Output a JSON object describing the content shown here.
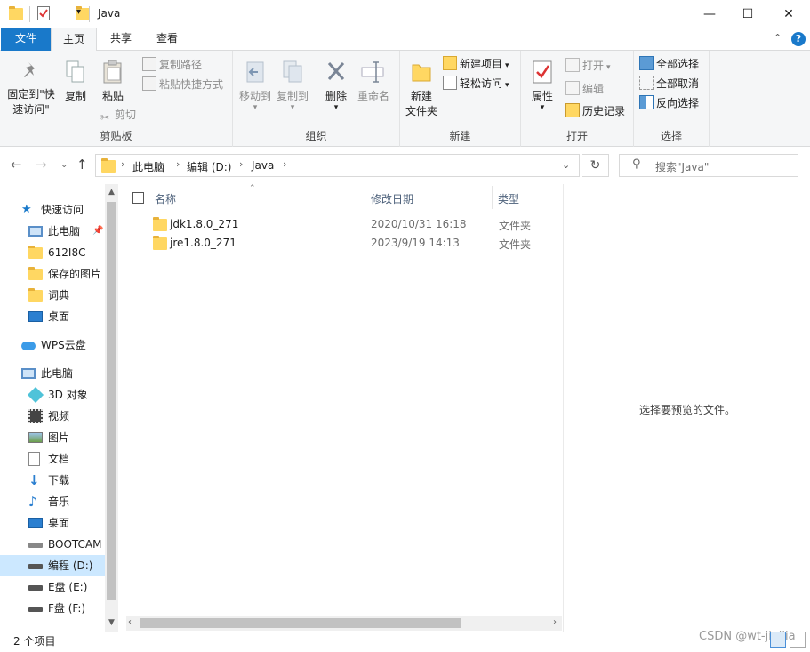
{
  "titlebar": {
    "title": "Java",
    "minimize": "—",
    "maximize": "☐",
    "close": "✕"
  },
  "tabs": {
    "file": "文件",
    "home": "主页",
    "share": "共享",
    "view": "查看"
  },
  "ribbon": {
    "clipboard": {
      "label": "剪贴板",
      "pin_line1": "固定到\"快",
      "pin_line2": "速访问\"",
      "copy": "复制",
      "paste": "粘贴",
      "copy_path": "复制路径",
      "paste_shortcut": "粘贴快捷方式",
      "cut": "剪切"
    },
    "organize": {
      "label": "组织",
      "move_to": "移动到",
      "copy_to": "复制到",
      "delete": "删除",
      "rename": "重命名"
    },
    "new": {
      "label": "新建",
      "new_folder_line1": "新建",
      "new_folder_line2": "文件夹",
      "new_item": "新建项目",
      "easy_access": "轻松访问"
    },
    "open": {
      "label": "打开",
      "properties": "属性",
      "open": "打开",
      "edit": "编辑",
      "history": "历史记录"
    },
    "select": {
      "label": "选择",
      "select_all": "全部选择",
      "select_none": "全部取消",
      "invert": "反向选择"
    }
  },
  "address": {
    "crumbs": [
      "此电脑",
      "编辑 (D:)",
      "Java"
    ],
    "search_placeholder": "搜索\"Java\""
  },
  "nav": {
    "items": [
      {
        "label": "快速访问",
        "icon": "star-icon"
      },
      {
        "label": "此电脑",
        "icon": "computer-icon"
      },
      {
        "label": "612I8C",
        "icon": "folder-icon"
      },
      {
        "label": "保存的图片",
        "icon": "folder-icon"
      },
      {
        "label": "词典",
        "icon": "folder-icon"
      },
      {
        "label": "桌面",
        "icon": "desktop-icon"
      },
      {
        "label": "WPS云盘",
        "icon": "cloud-icon"
      },
      {
        "label": "此电脑",
        "icon": "computer-icon"
      },
      {
        "label": "3D 对象",
        "icon": "cube-icon"
      },
      {
        "label": "视频",
        "icon": "film-icon"
      },
      {
        "label": "图片",
        "icon": "picture-icon"
      },
      {
        "label": "文档",
        "icon": "document-icon"
      },
      {
        "label": "下载",
        "icon": "download-icon"
      },
      {
        "label": "音乐",
        "icon": "music-icon"
      },
      {
        "label": "桌面",
        "icon": "desktop-icon"
      },
      {
        "label": "BOOTCAM",
        "icon": "drive-icon"
      },
      {
        "label": "编程 (D:)",
        "icon": "drive-icon"
      },
      {
        "label": "E盘 (E:)",
        "icon": "drive-icon"
      },
      {
        "label": "F盘 (F:)",
        "icon": "drive-icon"
      }
    ]
  },
  "filelist": {
    "columns": {
      "name": "名称",
      "date": "修改日期",
      "type": "类型"
    },
    "rows": [
      {
        "name": "jdk1.8.0_271",
        "date": "2020/10/31 16:18",
        "type": "文件夹"
      },
      {
        "name": "jre1.8.0_271",
        "date": "2023/9/19 14:13",
        "type": "文件夹"
      }
    ]
  },
  "preview": {
    "message": "选择要预览的文件。"
  },
  "status": {
    "count": "2 个项目"
  },
  "watermark": "CSDN @wt-jiaijia",
  "colors": {
    "accent": "#1979ca",
    "selected": "#cce8ff",
    "folder": "#ffd762"
  }
}
